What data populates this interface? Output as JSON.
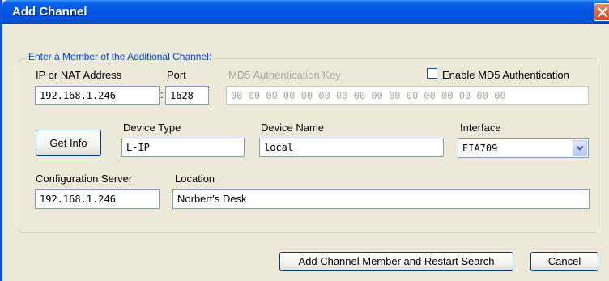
{
  "window": {
    "title": "Add Channel"
  },
  "group": {
    "legend": "Enter a Member of the Additional Channel:"
  },
  "fields": {
    "ip_label": "IP or NAT Address",
    "ip_value": "192.168.1.246",
    "colon": ":",
    "port_label": "Port",
    "port_value": "1628",
    "md5_key_label": "MD5 Authentication Key",
    "md5_key_value": "00 00 00 00 00 00 00 00 00 00 00 00 00 00 00 00",
    "md5_enable_label": "Enable MD5 Authentication",
    "md5_enable_checked": false,
    "get_info_label": "Get Info",
    "device_type_label": "Device Type",
    "device_type_value": "L-IP",
    "device_name_label": "Device Name",
    "device_name_value": "local",
    "interface_label": "Interface",
    "interface_value": "EIA709",
    "config_server_label": "Configuration Server",
    "config_server_value": "192.168.1.246",
    "location_label": "Location",
    "location_value": "Norbert's Desk"
  },
  "buttons": {
    "add_restart": "Add Channel Member and Restart Search",
    "cancel": "Cancel"
  },
  "icons": {
    "close": "close-icon",
    "dropdown": "chevron-down-icon"
  },
  "colors": {
    "titlebar": "#0054e3",
    "legend": "#0046d5",
    "dialog_bg": "#ece9d8",
    "close": "#d34a20"
  }
}
